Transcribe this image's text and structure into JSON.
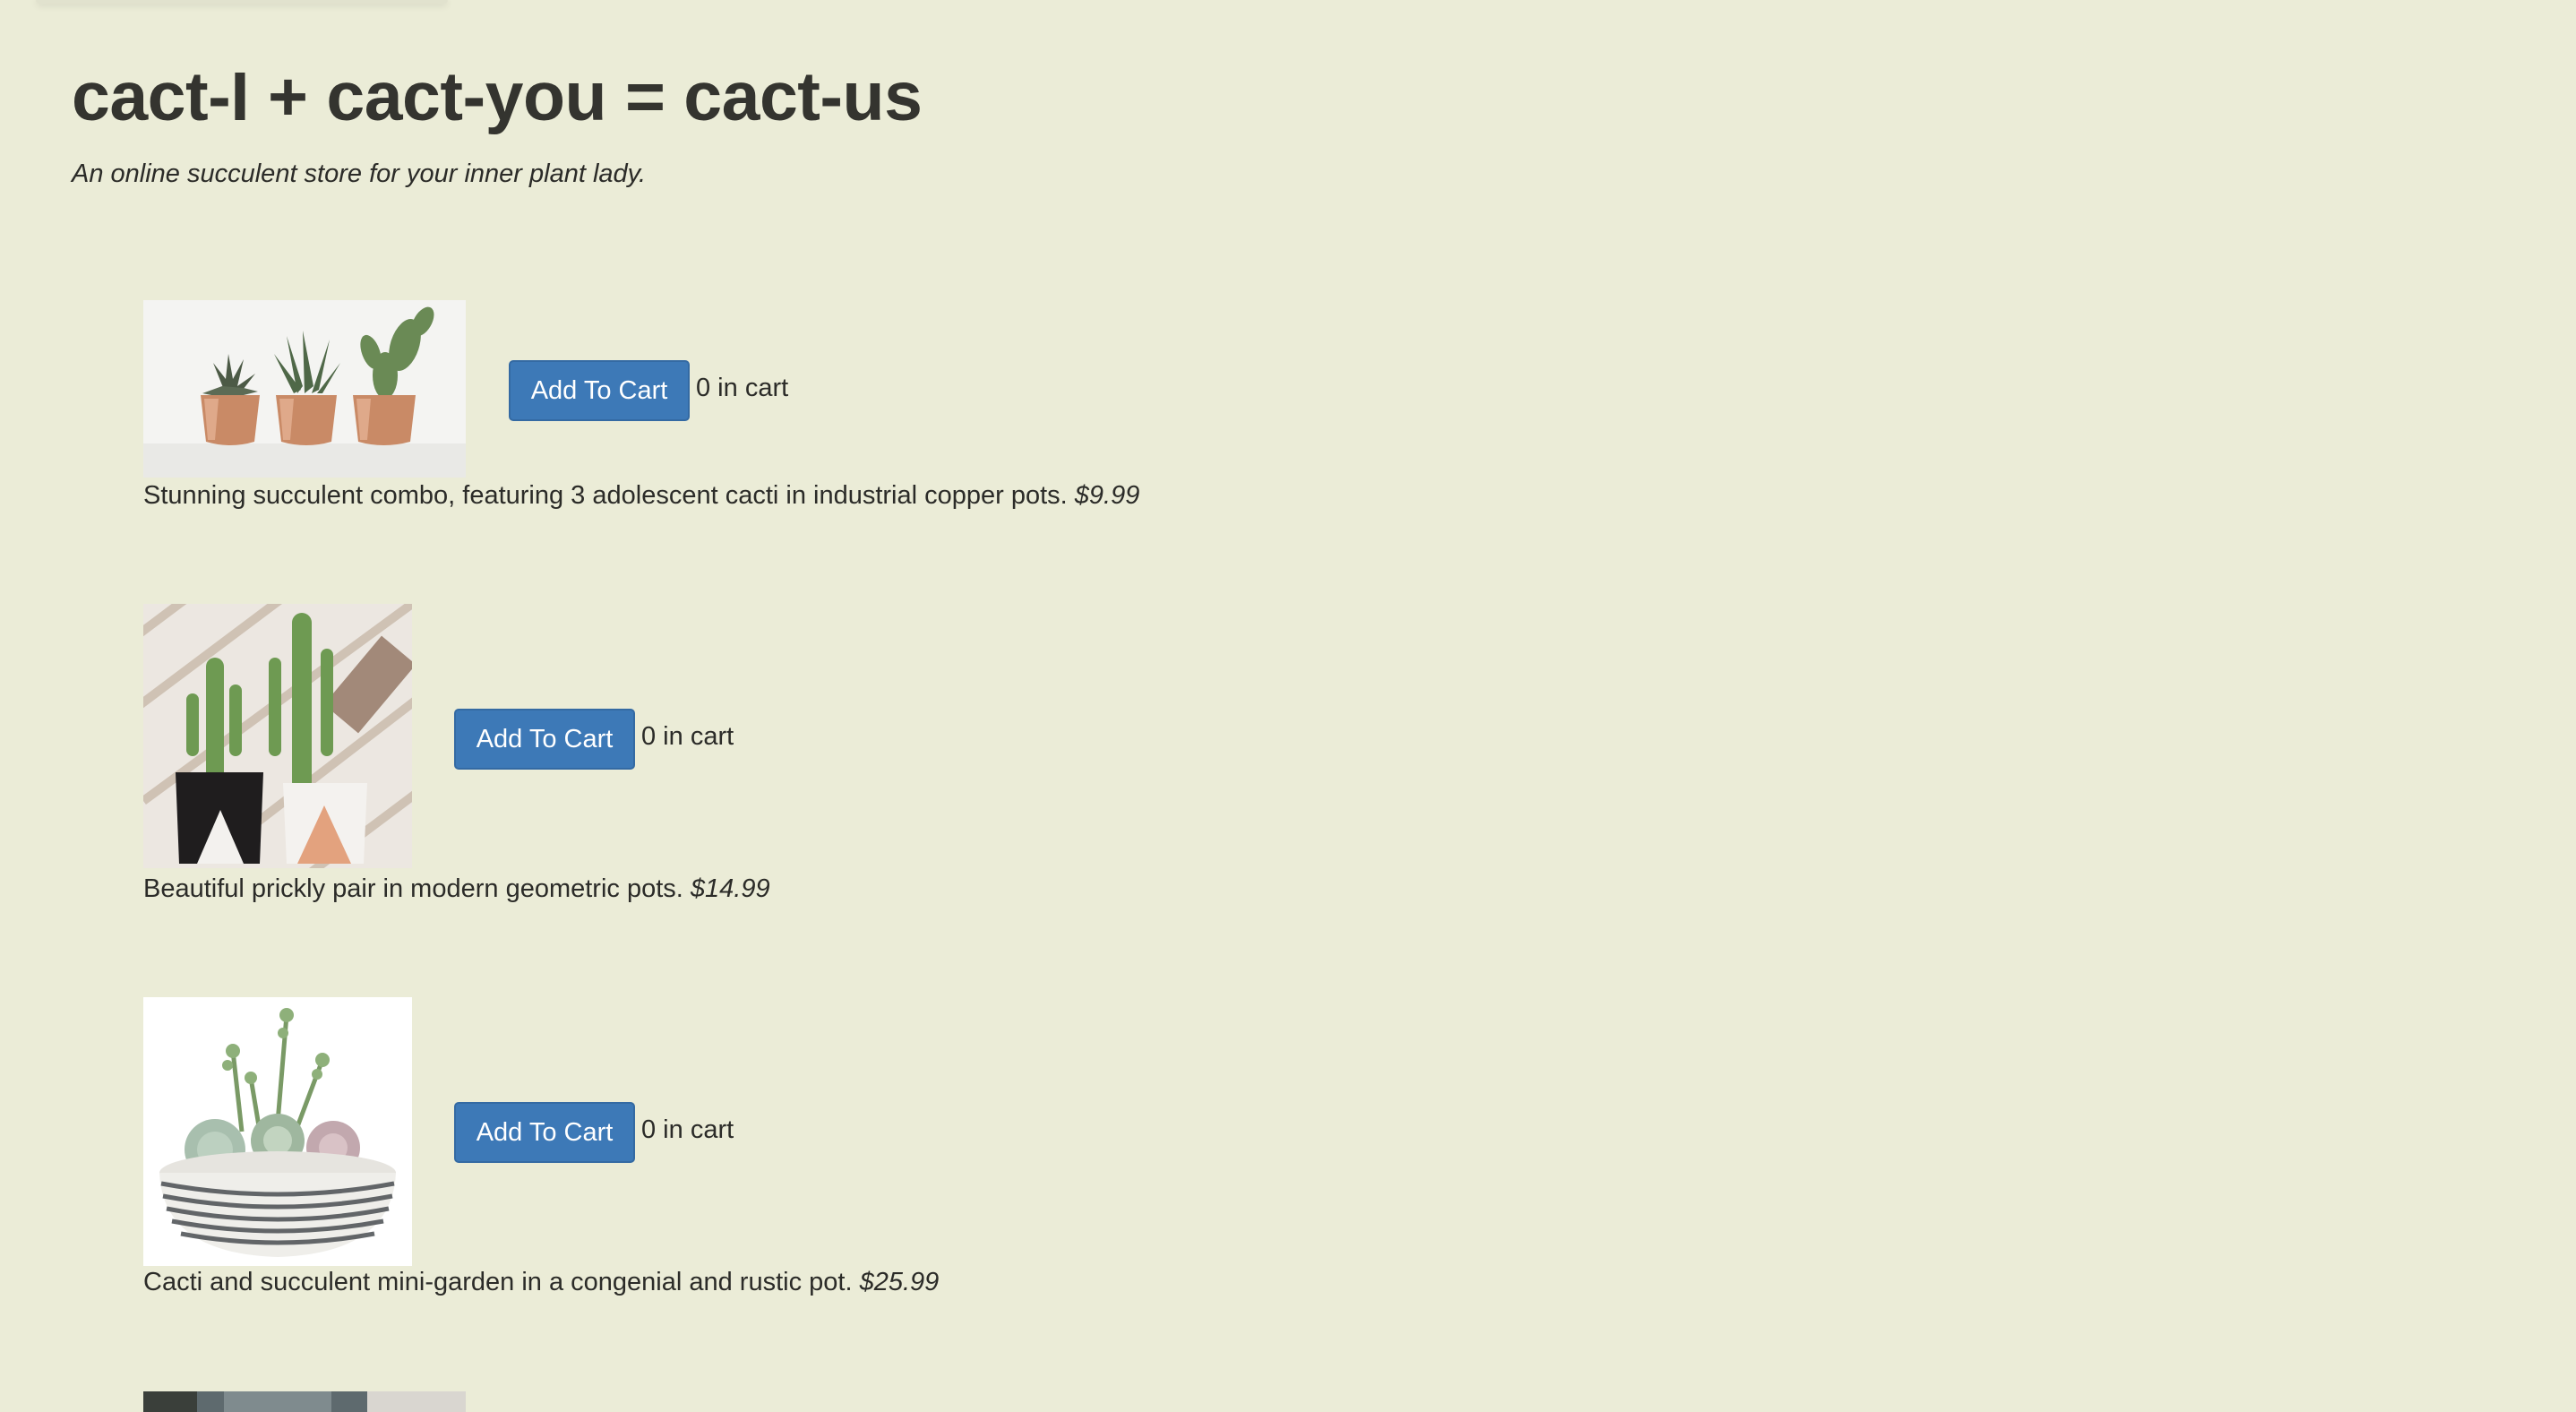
{
  "header": {
    "title": "cact-I + cact-you = cact-us",
    "tagline": "An online succulent store for your inner plant lady."
  },
  "products": [
    {
      "image_icon": "copper-pots-cacti-photo",
      "button_label": "Add To Cart",
      "cart_count": "0 in cart",
      "description": "Stunning succulent combo, featuring 3 adolescent cacti in industrial copper pots.",
      "price": "$9.99"
    },
    {
      "image_icon": "geometric-pots-cacti-photo",
      "button_label": "Add To Cart",
      "cart_count": "0 in cart",
      "description": "Beautiful prickly pair in modern geometric pots.",
      "price": "$14.99"
    },
    {
      "image_icon": "mini-garden-succulents-photo",
      "button_label": "Add To Cart",
      "cart_count": "0 in cart",
      "description": "Cacti and succulent mini-garden in a congenial and rustic pot.",
      "price": "$25.99"
    },
    {
      "image_icon": "partial-product-photo"
    }
  ],
  "colors": {
    "background": "#ebecd7",
    "button": "#3d79b7",
    "text": "#2f2f2a"
  }
}
